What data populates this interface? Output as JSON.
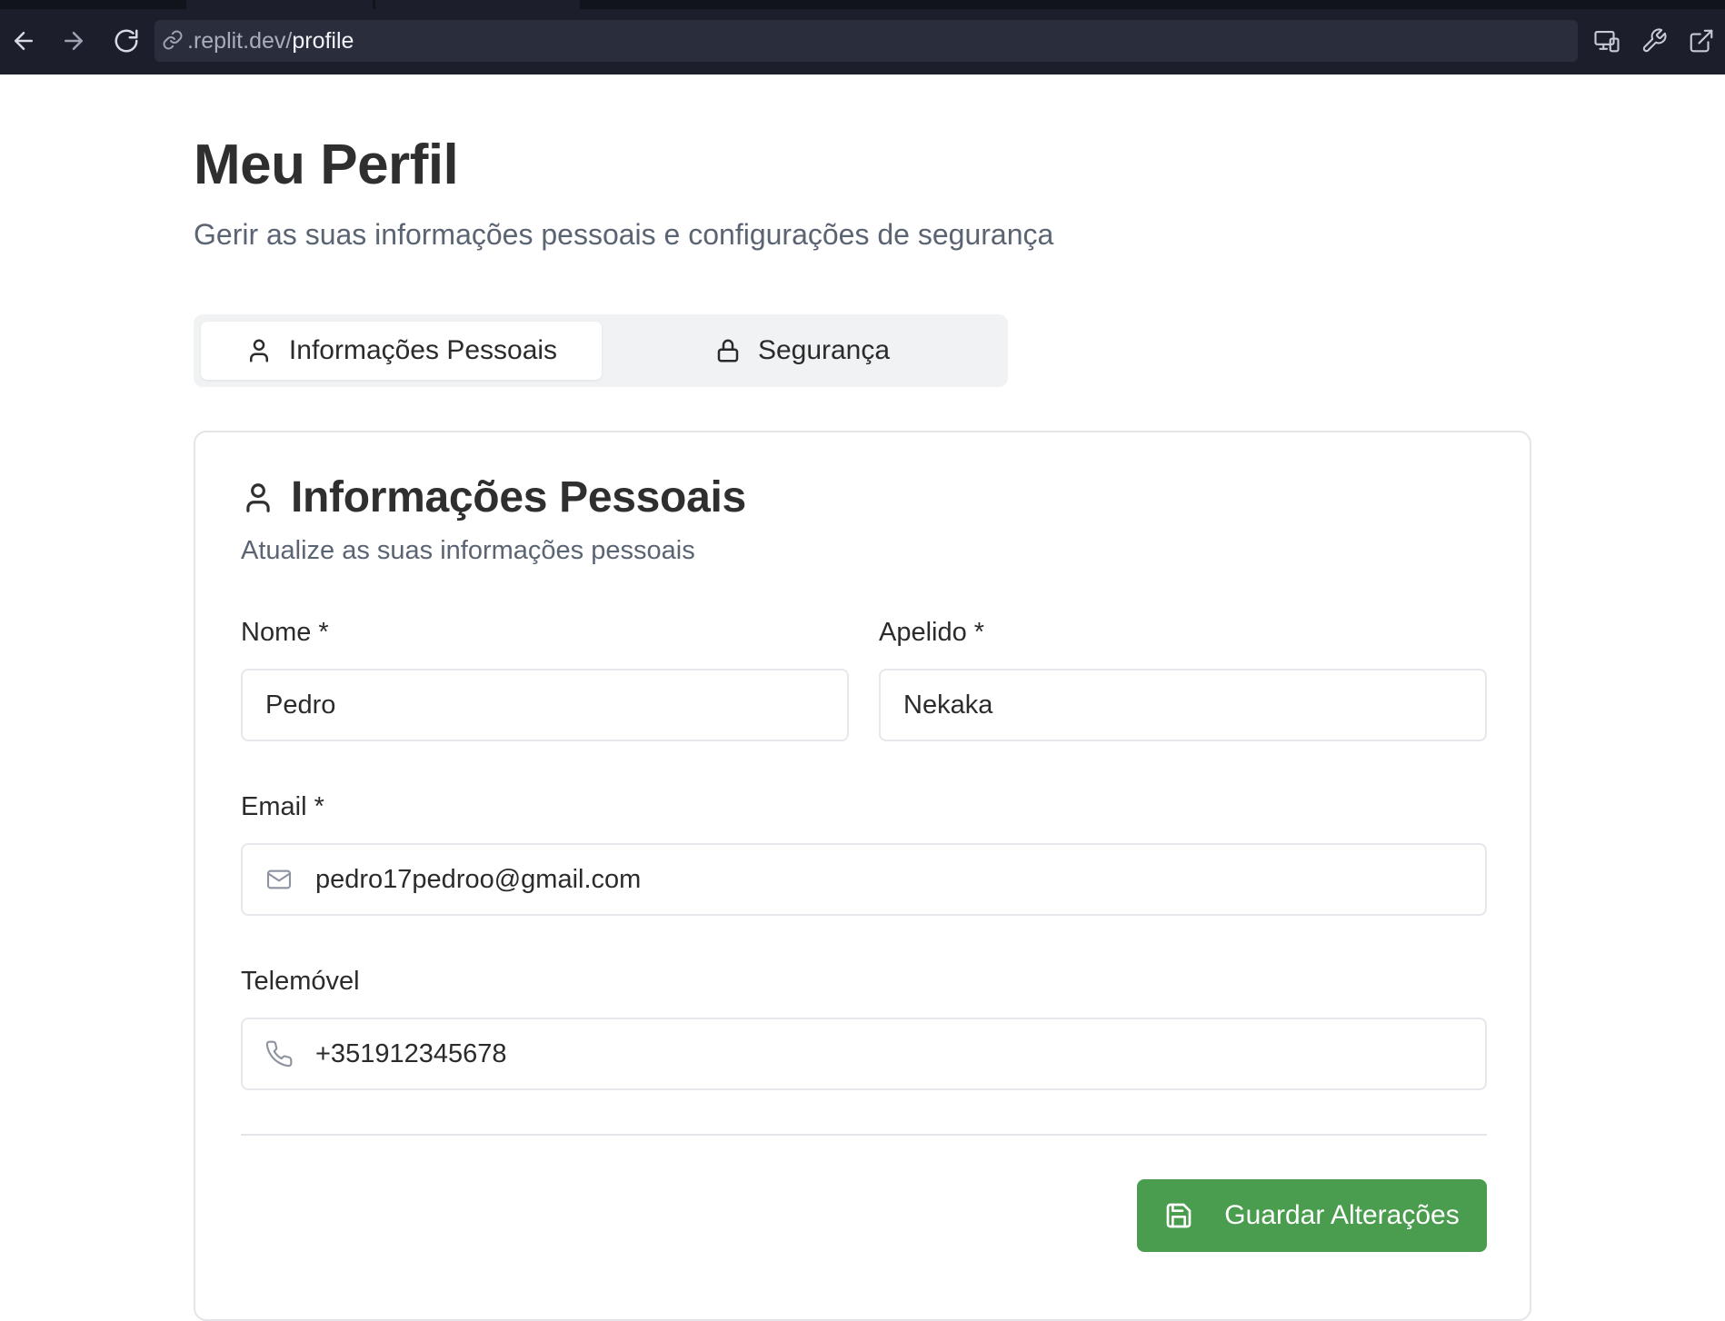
{
  "browser": {
    "url_host": ".replit.dev/",
    "url_path": "profile",
    "icons": {
      "back": "arrow-left-icon",
      "forward": "arrow-right-icon",
      "reload": "reload-icon",
      "link": "link-icon",
      "devices": "devices-icon",
      "wrench": "wrench-icon",
      "external": "external-link-icon"
    }
  },
  "page": {
    "title": "Meu Perfil",
    "subtitle": "Gerir as suas informações pessoais e configurações de segurança"
  },
  "tabs": [
    {
      "label": "Informações Pessoais",
      "icon": "user-icon",
      "active": true
    },
    {
      "label": "Segurança",
      "icon": "lock-icon",
      "active": false
    }
  ],
  "card": {
    "title": "Informações Pessoais",
    "subtitle": "Atualize as suas informações pessoais",
    "icon": "user-icon"
  },
  "form": {
    "first_name": {
      "label": "Nome *",
      "value": "Pedro"
    },
    "last_name": {
      "label": "Apelido *",
      "value": "Nekaka"
    },
    "email": {
      "label": "Email *",
      "value": "pedro17pedroo@gmail.com",
      "icon": "mail-icon"
    },
    "phone": {
      "label": "Telemóvel",
      "value": "+351912345678",
      "icon": "phone-icon"
    },
    "save_label": "Guardar Alterações",
    "save_icon": "save-icon"
  },
  "colors": {
    "accent": "#4a9d4e",
    "chrome_bg": "#1c1f2b"
  }
}
